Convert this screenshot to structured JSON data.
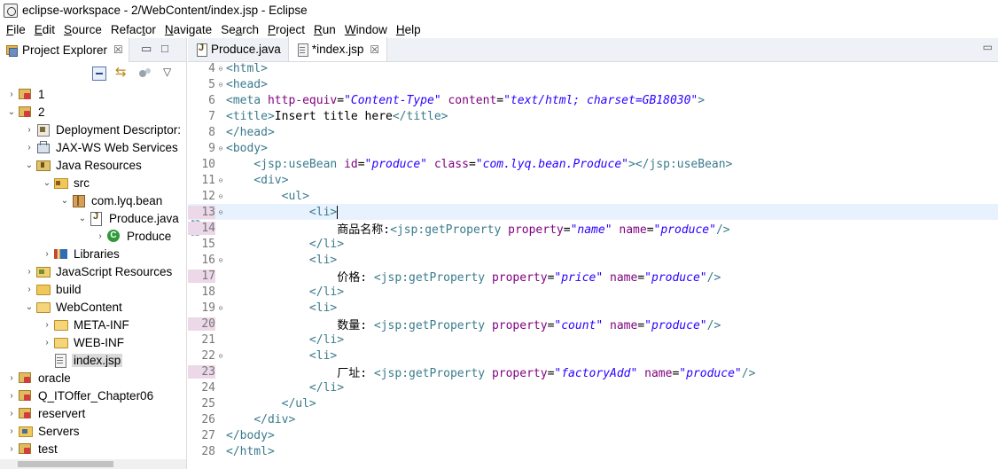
{
  "window": {
    "title": "eclipse-workspace - 2/WebContent/index.jsp - Eclipse"
  },
  "menu": [
    {
      "mn": "F",
      "rest": "ile"
    },
    {
      "mn": "E",
      "rest": "dit"
    },
    {
      "mn": "S",
      "rest": "ource"
    },
    {
      "mn": "",
      "rest": "Refac",
      "mn2": "t",
      "rest2": "or"
    },
    {
      "mn": "N",
      "rest": "avigate"
    },
    {
      "mn": "",
      "rest": "Se",
      "mn2": "a",
      "rest2": "rch"
    },
    {
      "mn": "P",
      "rest": "roject"
    },
    {
      "mn": "R",
      "rest": "un"
    },
    {
      "mn": "W",
      "rest": "indow"
    },
    {
      "mn": "H",
      "rest": "elp"
    }
  ],
  "explorer": {
    "tab_label": "Project Explorer",
    "tab_close": "☒",
    "min_glyph": "▭",
    "max_glyph": "□",
    "tree": [
      {
        "label": "1",
        "twisty": "›",
        "icon": "project"
      },
      {
        "label": "2",
        "twisty": "⌄",
        "icon": "project"
      },
      {
        "label": "Deployment Descriptor:",
        "twisty": "›",
        "icon": "dd"
      },
      {
        "label": "JAX-WS Web Services",
        "twisty": "›",
        "icon": "ws"
      },
      {
        "label": "Java Resources",
        "twisty": "⌄",
        "icon": "jres"
      },
      {
        "label": "src",
        "twisty": "⌄",
        "icon": "src"
      },
      {
        "label": "com.lyq.bean",
        "twisty": "⌄",
        "icon": "package"
      },
      {
        "label": "Produce.java",
        "twisty": "⌄",
        "icon": "java"
      },
      {
        "label": "Produce",
        "twisty": "›",
        "icon": "class"
      },
      {
        "label": "Libraries",
        "twisty": "›",
        "icon": "lib"
      },
      {
        "label": "JavaScript Resources",
        "twisty": "›",
        "icon": "jsres"
      },
      {
        "label": "build",
        "twisty": "›",
        "icon": "folder"
      },
      {
        "label": "WebContent",
        "twisty": "⌄",
        "icon": "folder-open"
      },
      {
        "label": "META-INF",
        "twisty": "›",
        "icon": "folder-open"
      },
      {
        "label": "WEB-INF",
        "twisty": "›",
        "icon": "folder-open"
      },
      {
        "label": "index.jsp",
        "twisty": "",
        "icon": "jsp"
      },
      {
        "label": "oracle",
        "twisty": "›",
        "icon": "project"
      },
      {
        "label": "Q_ITOffer_Chapter06",
        "twisty": "›",
        "icon": "project"
      },
      {
        "label": "reservert",
        "twisty": "›",
        "icon": "project"
      },
      {
        "label": "Servers",
        "twisty": "›",
        "icon": "servers"
      },
      {
        "label": "test",
        "twisty": "›",
        "icon": "project"
      }
    ]
  },
  "editor": {
    "tabs": [
      {
        "label": "Produce.java",
        "active": false
      },
      {
        "label": "*index.jsp",
        "active": true,
        "close": "☒"
      }
    ],
    "lines": [
      {
        "n": "4",
        "fold": "⊖",
        "parts": [
          [
            "tag",
            "<html>"
          ]
        ]
      },
      {
        "n": "5",
        "fold": "⊖",
        "parts": [
          [
            "tag",
            "<head>"
          ]
        ]
      },
      {
        "n": "6",
        "fold": "",
        "parts": [
          [
            "tag",
            "<meta "
          ],
          [
            "attr",
            "http-equiv"
          ],
          [
            "txt",
            "="
          ],
          [
            "val",
            "\"Content-Type\""
          ],
          [
            "txt",
            " "
          ],
          [
            "attr",
            "content"
          ],
          [
            "txt",
            "="
          ],
          [
            "val",
            "\"text/html; charset=GB18030\""
          ],
          [
            "tag",
            ">"
          ]
        ]
      },
      {
        "n": "7",
        "fold": "",
        "parts": [
          [
            "tag",
            "<title>"
          ],
          [
            "txt",
            "Insert title here"
          ],
          [
            "tag",
            "</title>"
          ]
        ]
      },
      {
        "n": "8",
        "fold": "",
        "parts": [
          [
            "tag",
            "</head>"
          ]
        ]
      },
      {
        "n": "9",
        "fold": "⊖",
        "parts": [
          [
            "tag",
            "<body>"
          ]
        ]
      },
      {
        "n": "10",
        "fold": "",
        "parts": [
          [
            "txt",
            "    "
          ],
          [
            "tag",
            "<jsp:useBean "
          ],
          [
            "attr",
            "id"
          ],
          [
            "txt",
            "="
          ],
          [
            "val",
            "\"produce\""
          ],
          [
            "txt",
            " "
          ],
          [
            "attr",
            "class"
          ],
          [
            "txt",
            "="
          ],
          [
            "val",
            "\"com.lyq.bean.Produce\""
          ],
          [
            "tag",
            "></jsp:useBean>"
          ]
        ]
      },
      {
        "n": "11",
        "fold": "⊖",
        "parts": [
          [
            "txt",
            "    "
          ],
          [
            "tag",
            "<div>"
          ]
        ]
      },
      {
        "n": "12",
        "fold": "⊖",
        "parts": [
          [
            "txt",
            "        "
          ],
          [
            "tag",
            "<ul>"
          ]
        ]
      },
      {
        "n": "13",
        "fold": "⊖",
        "current": true,
        "changed": true,
        "parts": [
          [
            "txt",
            "            "
          ],
          [
            "tag",
            "<li>"
          ]
        ]
      },
      {
        "n": "14",
        "fold": "",
        "changed": true,
        "parts": [
          [
            "txt",
            "                商品名称:"
          ],
          [
            "tag",
            "<jsp:getProperty "
          ],
          [
            "attr",
            "property"
          ],
          [
            "txt",
            "="
          ],
          [
            "val",
            "\"name\""
          ],
          [
            "txt",
            " "
          ],
          [
            "attr",
            "name"
          ],
          [
            "txt",
            "="
          ],
          [
            "val",
            "\"produce\""
          ],
          [
            "tag",
            "/>"
          ]
        ]
      },
      {
        "n": "15",
        "fold": "",
        "parts": [
          [
            "txt",
            "            "
          ],
          [
            "tag",
            "</li>"
          ]
        ]
      },
      {
        "n": "16",
        "fold": "⊖",
        "parts": [
          [
            "txt",
            "            "
          ],
          [
            "tag",
            "<li>"
          ]
        ]
      },
      {
        "n": "17",
        "fold": "",
        "changed": true,
        "parts": [
          [
            "txt",
            "                价格: "
          ],
          [
            "tag",
            "<jsp:getProperty "
          ],
          [
            "attr",
            "property"
          ],
          [
            "txt",
            "="
          ],
          [
            "val",
            "\"price\""
          ],
          [
            "txt",
            " "
          ],
          [
            "attr",
            "name"
          ],
          [
            "txt",
            "="
          ],
          [
            "val",
            "\"produce\""
          ],
          [
            "tag",
            "/>"
          ]
        ]
      },
      {
        "n": "18",
        "fold": "",
        "parts": [
          [
            "txt",
            "            "
          ],
          [
            "tag",
            "</li>"
          ]
        ]
      },
      {
        "n": "19",
        "fold": "⊖",
        "parts": [
          [
            "txt",
            "            "
          ],
          [
            "tag",
            "<li>"
          ]
        ]
      },
      {
        "n": "20",
        "fold": "",
        "changed": true,
        "parts": [
          [
            "txt",
            "                数量: "
          ],
          [
            "tag",
            "<jsp:getProperty "
          ],
          [
            "attr",
            "property"
          ],
          [
            "txt",
            "="
          ],
          [
            "val",
            "\"count\""
          ],
          [
            "txt",
            " "
          ],
          [
            "attr",
            "name"
          ],
          [
            "txt",
            "="
          ],
          [
            "val",
            "\"produce\""
          ],
          [
            "tag",
            "/>"
          ]
        ]
      },
      {
        "n": "21",
        "fold": "",
        "parts": [
          [
            "txt",
            "            "
          ],
          [
            "tag",
            "</li>"
          ]
        ]
      },
      {
        "n": "22",
        "fold": "⊖",
        "parts": [
          [
            "txt",
            "            "
          ],
          [
            "tag",
            "<li>"
          ]
        ]
      },
      {
        "n": "23",
        "fold": "",
        "changed": true,
        "parts": [
          [
            "txt",
            "                厂址: "
          ],
          [
            "tag",
            "<jsp:getProperty "
          ],
          [
            "attr",
            "property"
          ],
          [
            "txt",
            "="
          ],
          [
            "val",
            "\"factoryAdd\""
          ],
          [
            "txt",
            " "
          ],
          [
            "attr",
            "name"
          ],
          [
            "txt",
            "="
          ],
          [
            "val",
            "\"produce\""
          ],
          [
            "tag",
            "/>"
          ]
        ]
      },
      {
        "n": "24",
        "fold": "",
        "parts": [
          [
            "txt",
            "            "
          ],
          [
            "tag",
            "</li>"
          ]
        ]
      },
      {
        "n": "25",
        "fold": "",
        "parts": [
          [
            "txt",
            "        "
          ],
          [
            "tag",
            "</ul>"
          ]
        ]
      },
      {
        "n": "26",
        "fold": "",
        "parts": [
          [
            "txt",
            "    "
          ],
          [
            "tag",
            "</div>"
          ]
        ]
      },
      {
        "n": "27",
        "fold": "",
        "parts": [
          [
            "tag",
            "</body>"
          ]
        ]
      },
      {
        "n": "28",
        "fold": "",
        "parts": [
          [
            "tag",
            "</html>"
          ]
        ]
      }
    ]
  }
}
